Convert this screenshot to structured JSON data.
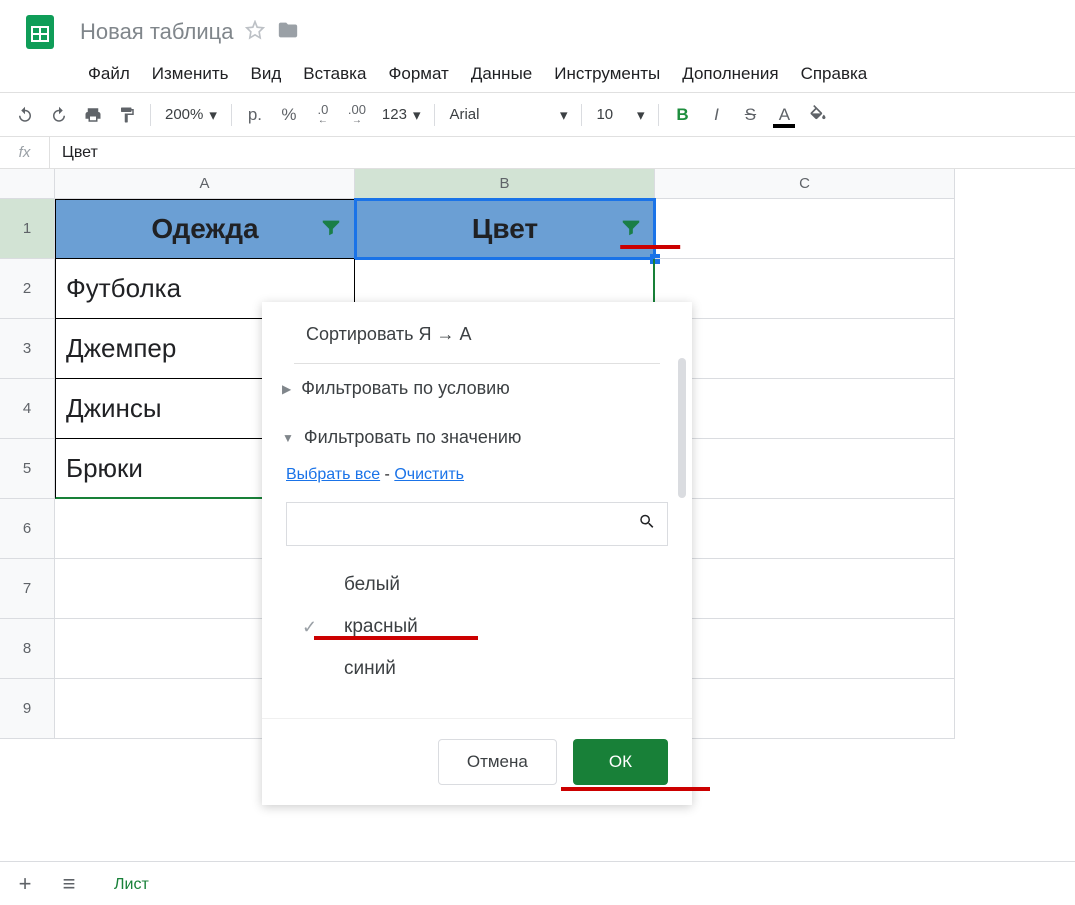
{
  "header": {
    "title": "Новая таблица"
  },
  "menu": {
    "file": "Файл",
    "edit": "Изменить",
    "view": "Вид",
    "insert": "Вставка",
    "format": "Формат",
    "data": "Данные",
    "tools": "Инструменты",
    "addons": "Дополнения",
    "help": "Справка"
  },
  "toolbar": {
    "zoom": "200%",
    "currency": "р.",
    "percent": "%",
    "dec_less": ".0",
    "dec_more": ".00",
    "num_fmt": "123",
    "font": "Arial",
    "size": "10",
    "bold": "B",
    "italic": "I",
    "strike": "S",
    "text_color": "A"
  },
  "formula": {
    "fx": "fx",
    "value": "Цвет"
  },
  "grid": {
    "cols": [
      "A",
      "B",
      "C"
    ],
    "rows": [
      "1",
      "2",
      "3",
      "4",
      "5",
      "6",
      "7",
      "8",
      "9"
    ],
    "headers": {
      "a": "Одежда",
      "b": "Цвет"
    },
    "data": {
      "a2": "Футболка",
      "a3": "Джемпер",
      "a4": "Джинсы",
      "a5": "Брюки"
    }
  },
  "filter": {
    "sort": "Сортировать Я → А",
    "by_condition": "Фильтровать по условию",
    "by_value": "Фильтровать по значению",
    "select_all": "Выбрать все",
    "sep": " - ",
    "clear": "Очистить",
    "search_value": "",
    "values": {
      "v1": "белый",
      "v2": "красный",
      "v3": "синий"
    },
    "cancel": "Отмена",
    "ok": "ОК"
  },
  "sheetbar": {
    "tab": "Лист"
  }
}
